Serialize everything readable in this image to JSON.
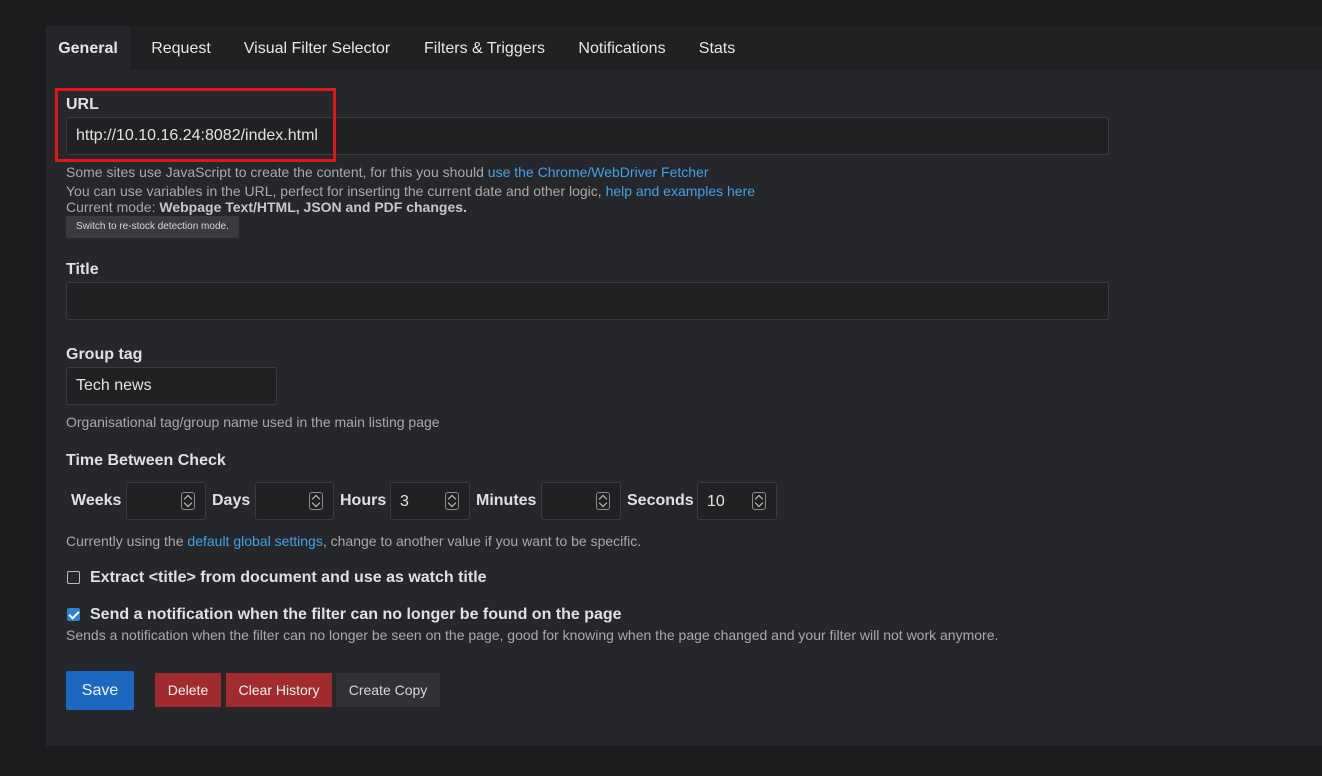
{
  "tabs": [
    {
      "label": "General"
    },
    {
      "label": "Request"
    },
    {
      "label": "Visual Filter Selector"
    },
    {
      "label": "Filters & Triggers"
    },
    {
      "label": "Notifications"
    },
    {
      "label": "Stats"
    }
  ],
  "url": {
    "label": "URL",
    "value": "http://10.10.16.24:8082/index.html",
    "help1_prefix": "Some sites use JavaScript to create the content, for this you should ",
    "help1_link": "use the Chrome/WebDriver Fetcher",
    "help2_prefix": "You can use variables in the URL, perfect for inserting the current date and other logic, ",
    "help2_link": "help and examples here",
    "mode_prefix": "Current mode: ",
    "mode_value": "Webpage Text/HTML, JSON and PDF changes.",
    "switch_button": "Switch to re-stock detection mode."
  },
  "title": {
    "label": "Title",
    "value": ""
  },
  "group_tag": {
    "label": "Group tag",
    "value": "Tech news",
    "help": "Organisational tag/group name used in the main listing page"
  },
  "time_between_check": {
    "label": "Time Between Check",
    "weeks_label": "Weeks",
    "weeks_value": "",
    "days_label": "Days",
    "days_value": "",
    "hours_label": "Hours",
    "hours_value": "3",
    "minutes_label": "Minutes",
    "minutes_value": "",
    "seconds_label": "Seconds",
    "seconds_value": "10",
    "help_prefix": "Currently using the ",
    "help_link": "default global settings",
    "help_suffix": ", change to another value if you want to be specific."
  },
  "extract_title": {
    "label": "Extract <title> from document and use as watch title",
    "checked": false
  },
  "filter_failure": {
    "label": "Send a notification when the filter can no longer be found on the page",
    "checked": true,
    "help": "Sends a notification when the filter can no longer be seen on the page, good for knowing when the page changed and your filter will not work anymore."
  },
  "actions": {
    "save": "Save",
    "delete": "Delete",
    "clear_history": "Clear History",
    "create_copy": "Create Copy"
  },
  "colors": {
    "accent_link": "#3da3e8",
    "save_button": "#1b69c1",
    "danger_button": "#a12b2e",
    "neutral_button": "#313235",
    "highlight_border": "#e11616",
    "checkbox_checked": "#2f7fd6"
  }
}
